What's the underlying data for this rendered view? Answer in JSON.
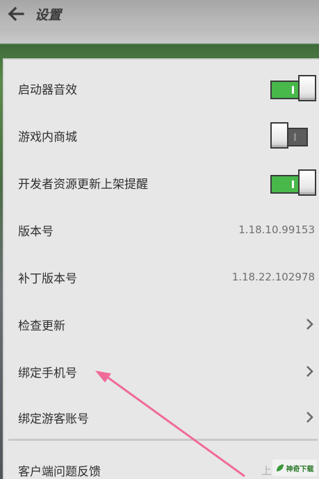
{
  "header": {
    "title": "设置"
  },
  "settings": {
    "launcher_sound": {
      "label": "启动器音效",
      "enabled": true
    },
    "in_game_store": {
      "label": "游戏内商城",
      "enabled": false
    },
    "dev_update_alert": {
      "label": "开发者资源更新上架提醒",
      "enabled": true
    },
    "version": {
      "label": "版本号",
      "value": "1.18.10.99153"
    },
    "patch_version": {
      "label": "补丁版本号",
      "value": "1.18.22.102978"
    },
    "check_update": {
      "label": "检查更新"
    },
    "bind_phone": {
      "label": "绑定手机号"
    },
    "bind_guest": {
      "label": "绑定游客账号"
    },
    "feedback": {
      "label": "客户端问题反馈",
      "value": "上"
    }
  },
  "watermark": {
    "text": "神奇下载"
  },
  "colors": {
    "toggle_on": "#48b84a",
    "annotation_arrow": "#f06a9a"
  }
}
